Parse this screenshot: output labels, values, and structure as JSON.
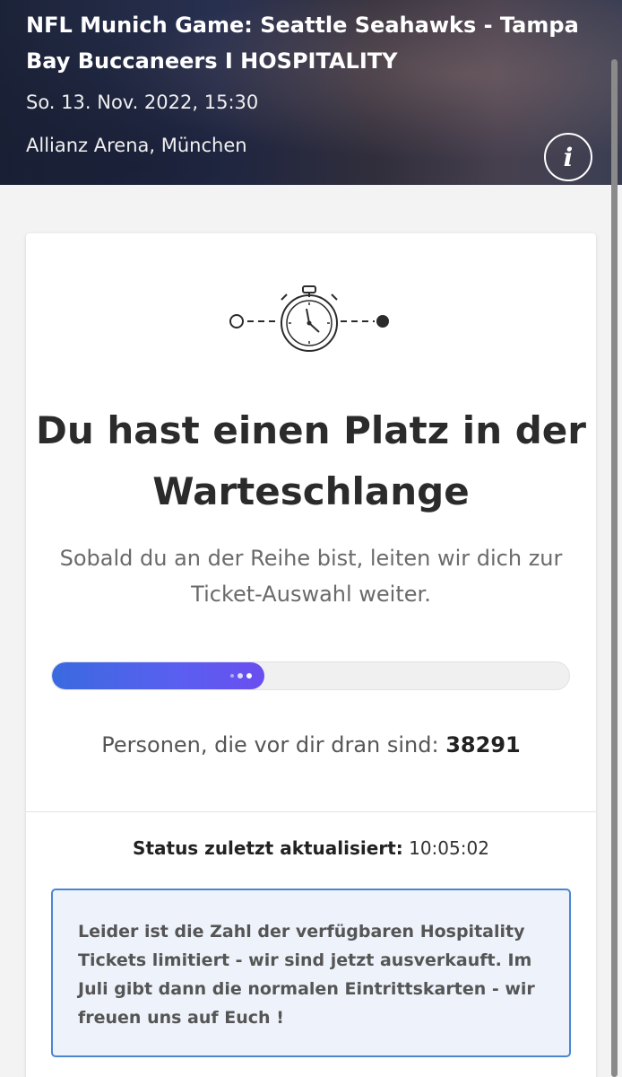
{
  "event": {
    "title": "NFL Munich Game: Seattle Seahawks - Tampa Bay Buccaneers I HOSPITALITY",
    "date": "So. 13. Nov. 2022, 15:30",
    "venue": "Allianz Arena, München",
    "info_label": "i"
  },
  "queue": {
    "headline": "Du hast einen Platz in der Warteschlange",
    "subline": "Sobald du an der Reihe bist, leiten wir dich zur Ticket-Auswahl weiter.",
    "progress_fraction": 0.41,
    "ahead_label": "Personen, die vor dir dran sind:",
    "ahead_count": "38291",
    "status_label": "Status zuletzt aktualisiert:",
    "status_time": "10:05:02"
  },
  "notice": {
    "text": "Leider ist die Zahl der verfügbaren Hospitality Tickets limitiert - wir sind jetzt ausverkauft. Im Juli gibt dann die normalen Eintrittskarten - wir freuen uns auf Euch !"
  },
  "colors": {
    "accent": "#4a6af0",
    "notice_border": "#4a86d0",
    "notice_bg": "#eef3fb"
  },
  "icons": {
    "queue": "stopwatch-icon",
    "info": "info-icon"
  }
}
